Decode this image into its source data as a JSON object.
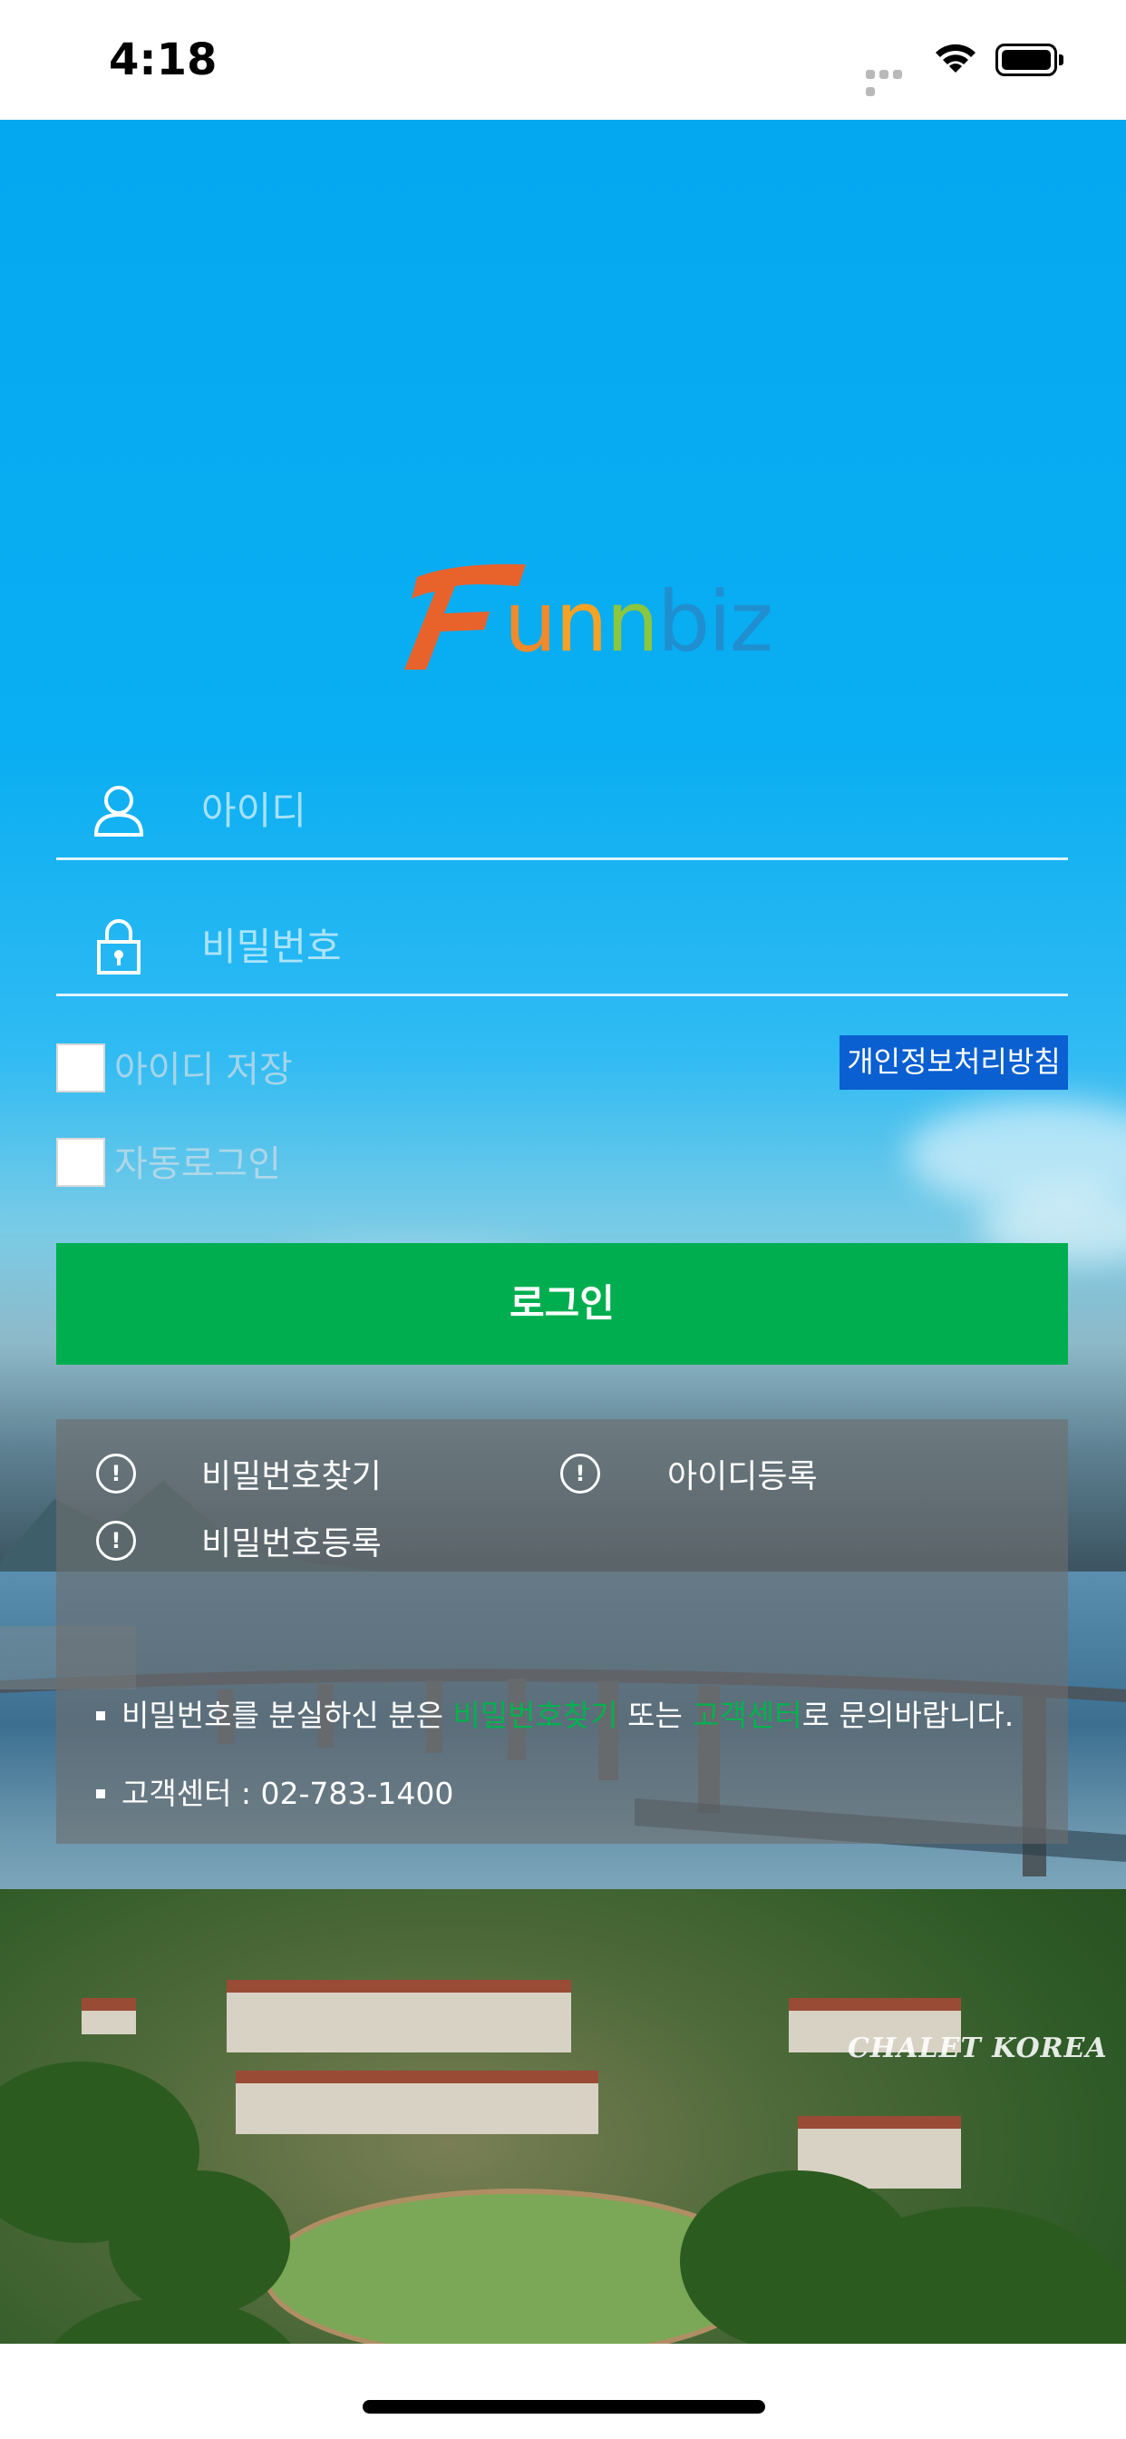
{
  "status_bar": {
    "time": "4:18"
  },
  "logo": {
    "text": "Funnbiz",
    "part_f": "F",
    "part_u": "u",
    "part_n1": "n",
    "part_n2": "n",
    "part_biz": "biz"
  },
  "login_form": {
    "id_placeholder": "아이디",
    "password_placeholder": "비밀번호",
    "save_id_label": "아이디 저장",
    "auto_login_label": "자동로그인",
    "privacy_policy_label": "개인정보처리방침",
    "login_button_label": "로그인"
  },
  "help_links": {
    "find_password": "비밀번호찾기",
    "register_id": "아이디등록",
    "register_password": "비밀번호등록",
    "alert_glyph": "!"
  },
  "notices": {
    "line1_prefix": "비밀번호를 분실하신 분은 ",
    "line1_link1": "비밀번호찾기",
    "line1_middle": " 또는 ",
    "line1_link2": "고객센터",
    "line1_suffix": "로 문의바랍니다.",
    "line2": "고객센터 : 02-783-1400"
  },
  "background": {
    "watermark": "CHALET KOREA"
  },
  "colors": {
    "sky": "#03a8f0",
    "login_green": "#00ae4f",
    "privacy_blue": "#0a5fd1",
    "logo_orange": "#e8622c",
    "link_green": "#00b24f"
  },
  "icons": {
    "user": "user-icon",
    "lock": "lock-icon",
    "alert": "alert-circle-icon",
    "wifi": "wifi-icon",
    "battery": "battery-icon",
    "signal": "signal-icon"
  }
}
